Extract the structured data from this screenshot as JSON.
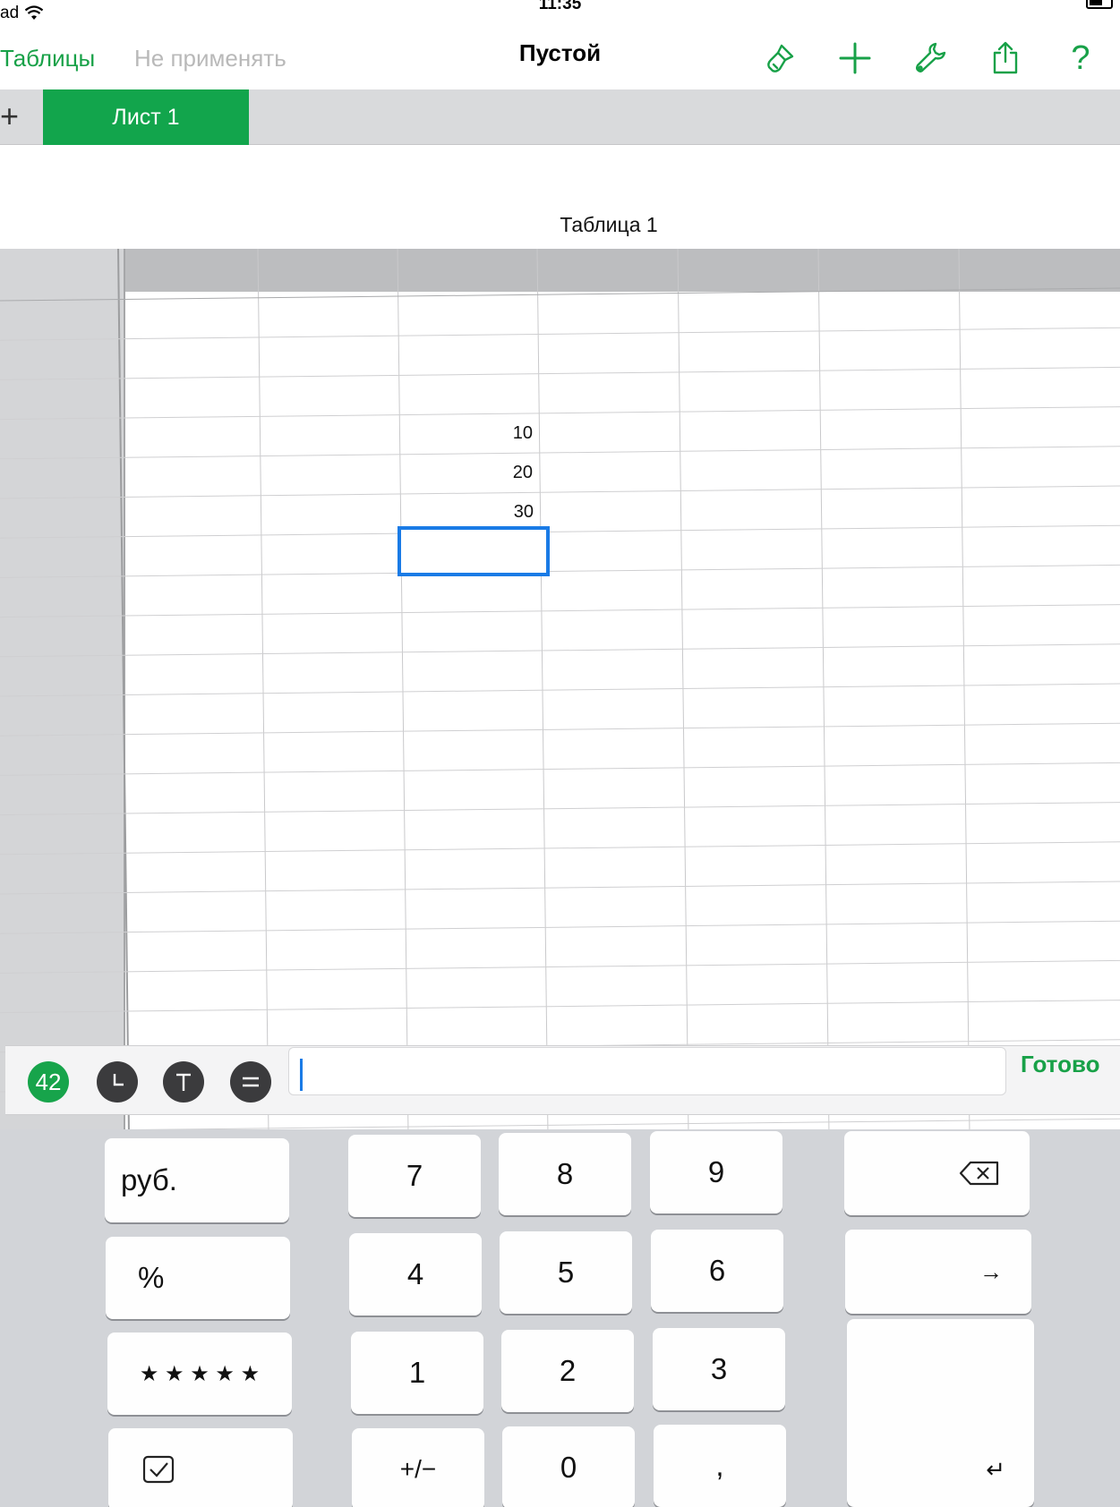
{
  "status_bar": {
    "device": "ad",
    "time": "11:35"
  },
  "nav": {
    "back_label": "Таблицы",
    "undo_label": "Не применять",
    "title": "Пустой",
    "icons": [
      "paintbrush-icon",
      "plus-icon",
      "wrench-icon",
      "share-icon",
      "help-icon"
    ],
    "help_glyph": "?"
  },
  "tabs": {
    "add_glyph": "+",
    "active_sheet": "Лист 1"
  },
  "table": {
    "title": "Таблица 1",
    "cells": [
      "10",
      "20",
      "30"
    ]
  },
  "input_bar": {
    "number_mode_label": "42",
    "done_label": "Готово",
    "value": ""
  },
  "keypad": {
    "keys": {
      "currency": "руб.",
      "percent": "%",
      "rating": "★ ★ ★ ★ ★",
      "k7": "7",
      "k8": "8",
      "k9": "9",
      "k4": "4",
      "k5": "5",
      "k6": "6",
      "k1": "1",
      "k2": "2",
      "k3": "3",
      "sign": "+/−",
      "k0": "0",
      "comma": ",",
      "next": "→",
      "enter": "↵"
    }
  },
  "colors": {
    "accent": "#18a148",
    "tab_active": "#12a54c",
    "selection": "#1a7be6"
  }
}
